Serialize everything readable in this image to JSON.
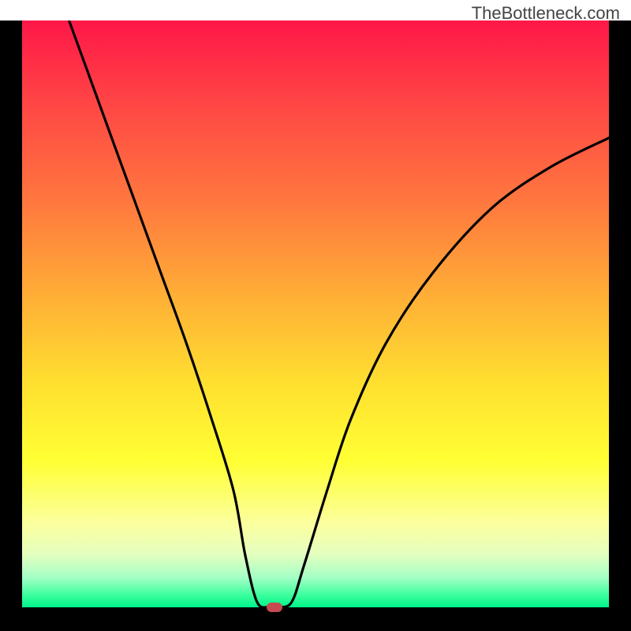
{
  "watermark": "TheBottleneck.com",
  "chart_data": {
    "type": "line",
    "title": "",
    "xlabel": "",
    "ylabel": "",
    "xlim": [
      0,
      100
    ],
    "ylim": [
      0,
      100
    ],
    "series": [
      {
        "name": "bottleneck-curve",
        "x": [
          8,
          12,
          16,
          20,
          24,
          28,
          32,
          36,
          38,
          40,
          42,
          44,
          46,
          48,
          52,
          56,
          62,
          70,
          80,
          90,
          100
        ],
        "values": [
          100,
          89,
          78,
          67,
          56,
          45,
          33,
          20,
          9,
          1,
          0,
          0,
          1,
          7,
          20,
          32,
          45,
          57,
          68,
          75,
          80
        ]
      }
    ],
    "marker": {
      "x": 43,
      "y": 0,
      "name": "optimal-point"
    },
    "gradient_colors": {
      "top": "#ff1748",
      "mid": "#ffff33",
      "bottom": "#00f38b"
    }
  }
}
